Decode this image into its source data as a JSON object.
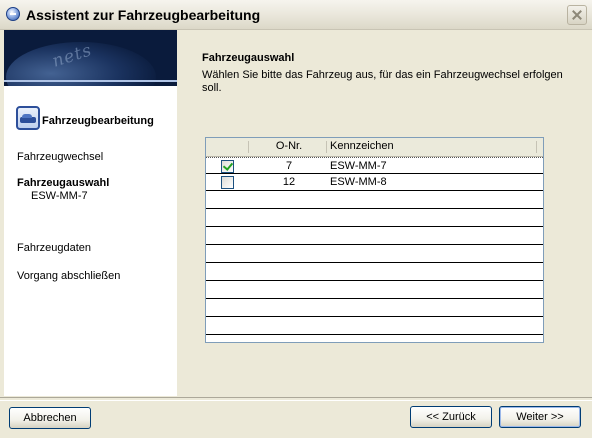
{
  "window": {
    "title": "Assistent zur Fahrzeugbearbeitung",
    "icon": "app-icon",
    "close_icon": "close-icon"
  },
  "sidebar": {
    "wizard_title": "Fahrzeugbearbeitung",
    "wizard_icon": "car-icon",
    "steps": [
      {
        "label": "Fahrzeugwechsel"
      },
      {
        "label": "Fahrzeugauswahl",
        "sub": "ESW-MM-7",
        "active": true
      },
      {
        "label": "Fahrzeugdaten"
      },
      {
        "label": "Vorgang abschließen"
      }
    ]
  },
  "content": {
    "title": "Fahrzeugauswahl",
    "description": "Wählen Sie bitte das Fahrzeug aus, für das ein Fahrzeugwechsel erfolgen soll."
  },
  "grid": {
    "columns": [
      "",
      "O-Nr.",
      "Kennzeichen"
    ],
    "rows": [
      {
        "checked": true,
        "onr": "7",
        "kennzeichen": "ESW-MM-7"
      },
      {
        "checked": false,
        "onr": "12",
        "kennzeichen": "ESW-MM-8"
      }
    ]
  },
  "buttons": {
    "cancel": "Abbrechen",
    "back": "<< Zurück",
    "next": "Weiter >>"
  }
}
